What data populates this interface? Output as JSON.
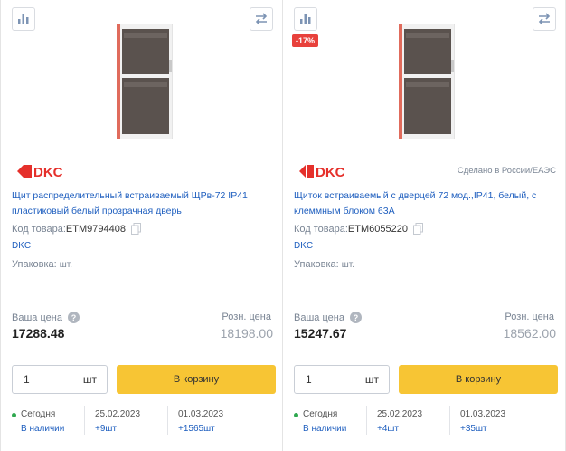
{
  "products": [
    {
      "discount": "",
      "brand": "DKC",
      "made_in": "",
      "title_line1": "Щит распределительный встраиваемый ЩРв-72 IP41",
      "title_line2": "пластиковый белый прозрачная дверь",
      "code_label": "Код товара:",
      "code": "ETM9794408",
      "manufacturer": "DKC",
      "pack_label": "Упаковка:",
      "pack_value": "шт.",
      "price_label": "Ваша цена",
      "price": "17288.48",
      "retail_label": "Розн. цена",
      "retail_price": "18198.00",
      "qty_value": "1",
      "qty_unit": "шт",
      "cart_label": "В корзину",
      "stock": [
        {
          "date": "Сегодня",
          "sub": "В наличии"
        },
        {
          "date": "25.02.2023",
          "sub": "+9шт"
        },
        {
          "date": "01.03.2023",
          "sub": "+1565шт"
        }
      ]
    },
    {
      "discount": "-17%",
      "brand": "DKC",
      "made_in": "Сделано в России/ЕАЭС",
      "title_line1": "Щиток встраиваемый с дверцей 72 мод.,IP41, белый, с",
      "title_line2": "клеммным блоком 63А",
      "code_label": "Код товара:",
      "code": "ETM6055220",
      "manufacturer": "DKC",
      "pack_label": "Упаковка:",
      "pack_value": "шт.",
      "price_label": "Ваша цена",
      "price": "15247.67",
      "retail_label": "Розн. цена",
      "retail_price": "18562.00",
      "qty_value": "1",
      "qty_unit": "шт",
      "cart_label": "В корзину",
      "stock": [
        {
          "date": "Сегодня",
          "sub": "В наличии"
        },
        {
          "date": "25.02.2023",
          "sub": "+4шт"
        },
        {
          "date": "01.03.2023",
          "sub": "+35шт"
        }
      ]
    }
  ],
  "colors": {
    "accent": "#f7c534",
    "link": "#1f5fbf",
    "brand": "#e5302b",
    "discount": "#e8413c",
    "in_stock": "#2fa84f"
  },
  "icons": {
    "chart": "bar-chart-icon",
    "compare": "compare-arrows-icon",
    "copy": "copy-icon",
    "help": "question-icon"
  }
}
